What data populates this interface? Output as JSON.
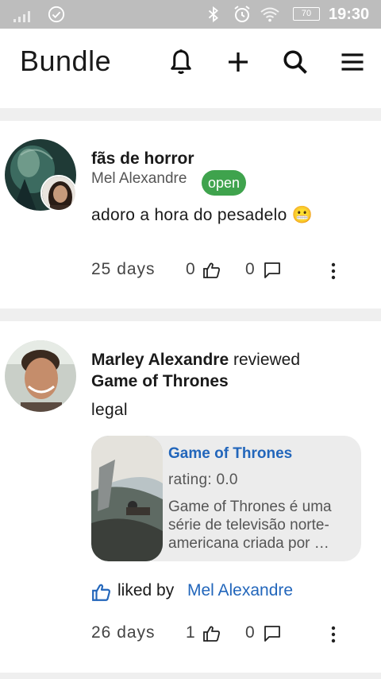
{
  "status_bar": {
    "battery": "70",
    "time": "19:30"
  },
  "app_bar": {
    "title": "Bundle",
    "icons": [
      "bell-icon",
      "plus-icon",
      "search-icon",
      "menu-icon"
    ]
  },
  "feed": [
    {
      "title": "fãs de horror",
      "author": "Mel Alexandre",
      "badge": "open",
      "text": "adoro a hora do pesadelo 😬",
      "time": "25 days",
      "likes": "0",
      "comments": "0"
    },
    {
      "user": "Marley Alexandre",
      "action": "reviewed",
      "subject": "Game of Thrones",
      "text": "legal",
      "media": {
        "title": "Game of Thrones",
        "rating": "rating: 0.0",
        "description": "Game of Thrones é uma série de televisão norte-americana criada por …"
      },
      "liked_by_label": "liked by",
      "liked_by_name": "Mel Alexandre",
      "time": "26 days",
      "likes": "1",
      "comments": "0"
    }
  ],
  "colors": {
    "accent_blue": "#2266bb",
    "badge_green": "#3fa34d",
    "status_bar": "#bdbdbd",
    "divider": "#efefef"
  }
}
